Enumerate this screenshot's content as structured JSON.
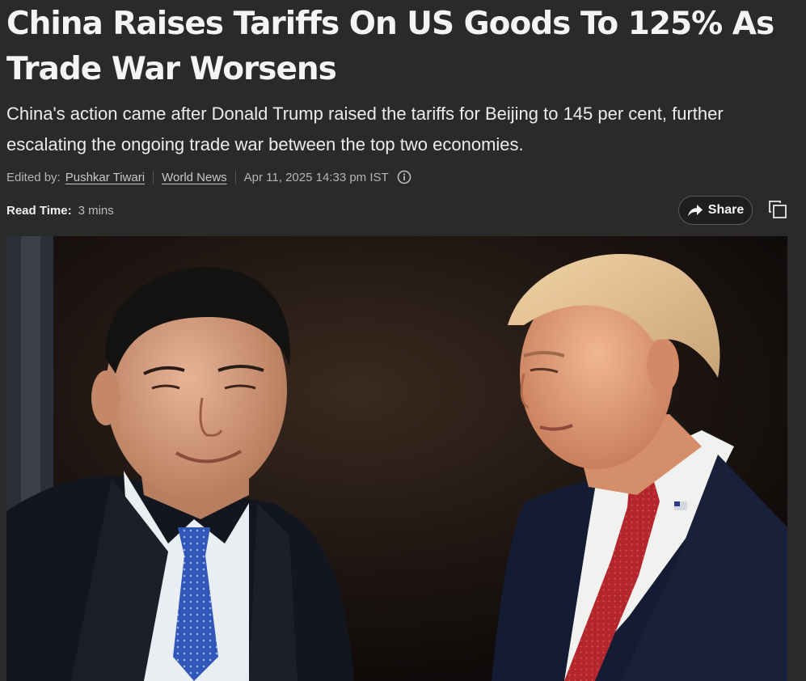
{
  "article": {
    "headline": "China Raises Tariffs On US Goods To 125% As Trade War Worsens",
    "subheadline": "China's action came after Donald Trump raised the tariffs for Beijing to 145 per cent, further escalating the ongoing trade war between the top two economies.",
    "byline": {
      "edited_by_label": "Edited by:",
      "editor": "Pushkar Tiwari",
      "category": "World News",
      "timestamp": "Apr 11, 2025 14:33 pm IST",
      "info_icon": "info-circle-icon"
    },
    "read_time": {
      "label": "Read Time:",
      "value": "3 mins"
    },
    "actions": {
      "share_label": "Share",
      "share_icon": "share-arrow-icon",
      "copy_icon": "copy-icon"
    },
    "hero_image": {
      "alt": "Xi Jinping and Donald Trump"
    }
  },
  "colors": {
    "background": "#2a2a2a",
    "text": "#f2f2f2",
    "muted": "#b5b5b5",
    "button_border": "#5a5a5a"
  }
}
